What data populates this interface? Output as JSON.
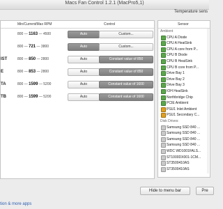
{
  "window": {
    "title": "Macs Fan Control 1.2.1 (MacPro5,1)"
  },
  "temperature_sensor_source": "Temperature sens",
  "fans_header": {
    "rpm": "Min/Current/Max RPM",
    "control": "Control"
  },
  "fans": [
    {
      "name": "",
      "min": "800",
      "current": "1163",
      "max": "4500",
      "auto": "Auto",
      "custom": "Custom...",
      "custom_active": false
    },
    {
      "name": "",
      "min": "800",
      "current": "721",
      "max": "3800",
      "auto": "Auto",
      "custom": "Custom...",
      "custom_active": false
    },
    {
      "name": "IST",
      "min": "800",
      "current": "850",
      "max": "2800",
      "auto": "Auto",
      "custom": "Constant value of 850",
      "custom_active": true
    },
    {
      "name": "E",
      "min": "800",
      "current": "853",
      "max": "2800",
      "auto": "Auto",
      "custom": "Constant value of 850",
      "custom_active": true
    },
    {
      "name": "TA",
      "min": "800",
      "current": "1599",
      "max": "5200",
      "auto": "Auto",
      "custom": "Constant value of 1600",
      "custom_active": true
    },
    {
      "name": "TB",
      "min": "800",
      "current": "1599",
      "max": "5200",
      "auto": "Auto",
      "custom": "Constant value of 1600",
      "custom_active": true
    }
  ],
  "sensors_header": "Sensor",
  "sensors": [
    {
      "label": "Ambient",
      "kind": "group"
    },
    {
      "label": "CPU A Diode",
      "kind": "chip"
    },
    {
      "label": "CPU A HeatSink",
      "kind": "chip"
    },
    {
      "label": "CPU A core from P...",
      "kind": "chip"
    },
    {
      "label": "CPU B Diode",
      "kind": "chip"
    },
    {
      "label": "CPU B HeatSink",
      "kind": "chip"
    },
    {
      "label": "CPU B core from P...",
      "kind": "chip"
    },
    {
      "label": "Drive Bay 1",
      "kind": "chip"
    },
    {
      "label": "Drive Bay 2",
      "kind": "chip"
    },
    {
      "label": "Drive Bay 3",
      "kind": "chip"
    },
    {
      "label": "IOH HeatSink",
      "kind": "chip"
    },
    {
      "label": "Northbridge Chip",
      "kind": "chip"
    },
    {
      "label": "PCIE Ambient",
      "kind": "chip"
    },
    {
      "label": "PSU1 Inlet Ambient",
      "kind": "psu"
    },
    {
      "label": "PSU1 Secondary C...",
      "kind": "psu"
    },
    {
      "label": "Disk Drives:",
      "kind": "group"
    },
    {
      "label": "Samsung SSD 840 ...",
      "kind": "disk"
    },
    {
      "label": "Samsung SSD 840 ...",
      "kind": "disk"
    },
    {
      "label": "Samsung SSD 840 ...",
      "kind": "disk"
    },
    {
      "label": "Samsung SSD 840 ...",
      "kind": "disk"
    },
    {
      "label": "WDC WD1001FALS...",
      "kind": "disk"
    },
    {
      "label": "ST1000DX001-1CM...",
      "kind": "disk"
    },
    {
      "label": "ST3500410AS",
      "kind": "disk"
    },
    {
      "label": "ST3500410AS",
      "kind": "disk"
    }
  ],
  "buttons": {
    "hide_to_menu_bar": "Hide to menu bar",
    "preferences": "Pre"
  },
  "footer": {
    "link": "tion & more apps"
  }
}
